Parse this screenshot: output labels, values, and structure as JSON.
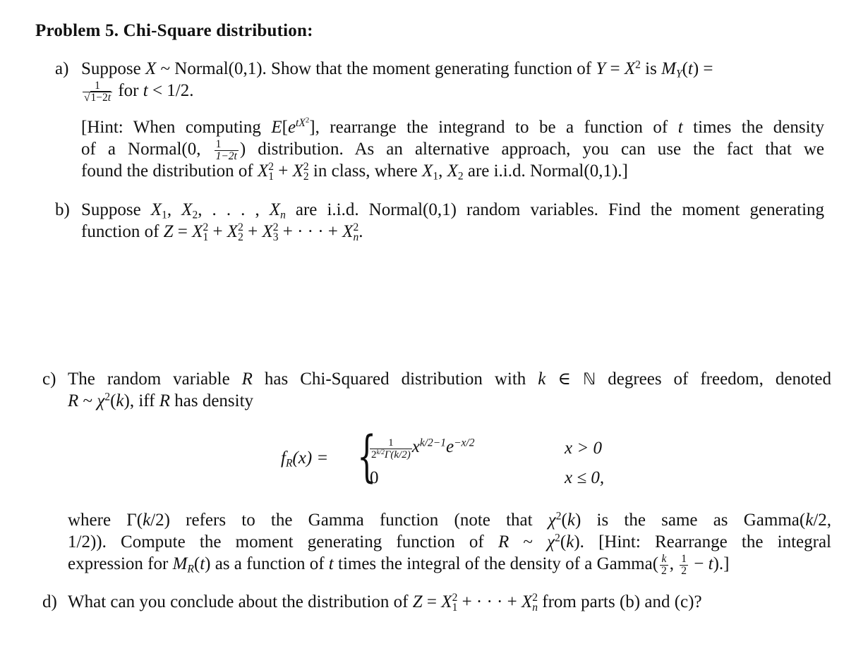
{
  "problem": {
    "title": "Problem 5. Chi-Square distribution:"
  },
  "parts": {
    "a": {
      "label": "a)",
      "line1": {
        "t1": "Suppose ",
        "X": "X",
        "t2": " ~ Normal(0,1). Show that the moment generating function of ",
        "Y": "Y",
        "t3": " = ",
        "X2": "X",
        "exp2": "2",
        "t4": " is ",
        "M": "M",
        "Msub": "Y",
        "t5": "(",
        "t": "t",
        "t6": ") ="
      },
      "line2": {
        "frac_num": "1",
        "frac_den_pre": "√",
        "frac_den": "1−2",
        "frac_den_t": "t",
        "t1": " for ",
        "t": "t",
        "t2": " < 1/2."
      },
      "hint": {
        "l1_a": "[Hint: When computing ",
        "l1_E": "E",
        "l1_b": "[",
        "l1_e": "e",
        "l1_exp": "tX",
        "l1_exp2": "2",
        "l1_c": "], rearrange the integrand to be a function of ",
        "l1_t": "t",
        "l1_d": " times the density",
        "l2_a": "of a Normal(0, ",
        "l2_num": "1",
        "l2_den": "1−2t",
        "l2_b": ") distribution.  As an alternative approach, you can use the fact that we",
        "l3_a": "found the distribution of ",
        "l3_X1": "X",
        "l3_sup1": "2",
        "l3_sub1": "1",
        "l3_plus": " + ",
        "l3_X2": "X",
        "l3_sup2": "2",
        "l3_sub2": "2",
        "l3_b": " in class, where ",
        "l3_X1b": "X",
        "l3_sub1b": "1",
        "l3_comma": ", ",
        "l3_X2b": "X",
        "l3_sub2b": "2",
        "l3_c": " are i.i.d. Normal(0,1).]"
      }
    },
    "b": {
      "label": "b)",
      "l1_a": "Suppose ",
      "l1_X1": "X",
      "l1_s1": "1",
      "l1_c1": ", ",
      "l1_X2": "X",
      "l1_s2": "2",
      "l1_dots": ", . . . , ",
      "l1_Xn": "X",
      "l1_sn": "n",
      "l1_b": " are i.i.d. Normal(0,1) random variables. Find the moment generating",
      "l2_a": "function of ",
      "l2_Z": "Z",
      "l2_eq": " = ",
      "terms": [
        {
          "X": "X",
          "sup": "2",
          "sub": "1",
          "after": " + "
        },
        {
          "X": "X",
          "sup": "2",
          "sub": "2",
          "after": " + "
        },
        {
          "X": "X",
          "sup": "2",
          "sub": "3",
          "after": " + · · · + "
        },
        {
          "X": "X",
          "sup": "2",
          "sub": "n",
          "after": "."
        }
      ]
    },
    "c": {
      "label": "c)",
      "l1_a": "The random variable ",
      "l1_R": "R",
      "l1_b": " has Chi-Squared distribution with ",
      "l1_k": "k",
      "l1_in": " ∈ ",
      "l1_N": "ℕ",
      "l1_c": " degrees of freedom, denoted",
      "l2_R": "R",
      "l2_a": " ~ ",
      "l2_chi": "χ",
      "l2_sup": "2",
      "l2_b": "(",
      "l2_k": "k",
      "l2_c": "), iff ",
      "l2_R2": "R",
      "l2_d": " has density",
      "density": {
        "lhs_f": "f",
        "lhs_sub": "R",
        "lhs_rest": "(x) =",
        "row1_num": "1",
        "row1_den": "2^{k/2}Γ(k/2)",
        "row1_den_base": "2",
        "row1_den_exp": "k/2",
        "row1_den_gamma": "Γ(k/2)",
        "row1_x": "x",
        "row1_xexp": "k/2−1",
        "row1_e": "e",
        "row1_eexp": "−x/2",
        "row1_cond": "x > 0",
        "row2_val": "0",
        "row2_cond": "x ≤ 0,"
      },
      "p_l1_a": "where Γ(",
      "p_l1_k": "k",
      "p_l1_b": "/2) refers to the Gamma function (note that ",
      "p_l1_chi": "χ",
      "p_l1_sup": "2",
      "p_l1_c": "(",
      "p_l1_k2": "k",
      "p_l1_d": ") is the same as Gamma(",
      "p_l1_k3": "k",
      "p_l1_e": "/2,",
      "p_l2_a": "1/2)). Compute the moment generating function of ",
      "p_l2_R": "R",
      "p_l2_b": " ~ ",
      "p_l2_chi": "χ",
      "p_l2_sup": "2",
      "p_l2_c": "(",
      "p_l2_k": "k",
      "p_l2_d": "). [Hint: Rearrange the integral",
      "p_l3_a": "expression for ",
      "p_l3_M": "M",
      "p_l3_sub": "R",
      "p_l3_b": "(",
      "p_l3_t": "t",
      "p_l3_c": ") as a function of ",
      "p_l3_t2": "t",
      "p_l3_d": " times the integral of the density of a Gamma(",
      "p_l3_f1num": "k",
      "p_l3_f1den": "2",
      "p_l3_comma": ", ",
      "p_l3_f2num": "1",
      "p_l3_f2den": "2",
      "p_l3_e": " − ",
      "p_l3_t3": "t",
      "p_l3_f": ").]"
    },
    "d": {
      "label": "d)",
      "a": "What can you conclude about the distribution of ",
      "Z": "Z",
      "eq": " = ",
      "X1": "X",
      "sup1": "2",
      "sub1": "1",
      "mid": " + · · · + ",
      "Xn": "X",
      "supn": "2",
      "subn": "n",
      "b": " from parts (b) and (c)?"
    }
  }
}
